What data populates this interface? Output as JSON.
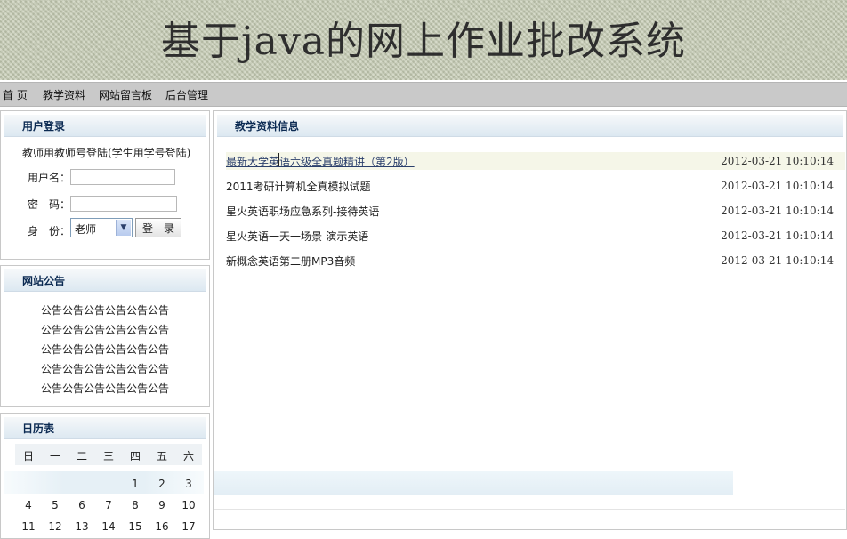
{
  "banner": {
    "title": "基于java的网上作业批改系统"
  },
  "nav": [
    {
      "label": "首 页"
    },
    {
      "label": "教学资料"
    },
    {
      "label": "网站留言板"
    },
    {
      "label": "后台管理"
    }
  ],
  "login": {
    "title": "用户登录",
    "hint": "教师用教师号登陆(学生用学号登陆)",
    "username_label": "用户名：",
    "username_value": "",
    "password_label": "密　码：",
    "password_value": "",
    "role_label": "身　份：",
    "role_value": "老师",
    "submit_label": "登　录"
  },
  "notice": {
    "title": "网站公告",
    "lines": [
      "公告公告公告公告公告公告",
      "公告公告公告公告公告公告",
      "公告公告公告公告公告公告",
      "公告公告公告公告公告公告",
      "公告公告公告公告公告公告"
    ]
  },
  "calendar": {
    "title": "日历表",
    "weekdays": [
      "日",
      "一",
      "二",
      "三",
      "四",
      "五",
      "六"
    ],
    "rows": [
      [
        "",
        "",
        "",
        "",
        "1",
        "2",
        "3"
      ],
      [
        "4",
        "5",
        "6",
        "7",
        "8",
        "9",
        "10"
      ],
      [
        "11",
        "12",
        "13",
        "14",
        "15",
        "16",
        "17"
      ]
    ]
  },
  "resources": {
    "title": "教学资料信息",
    "items": [
      {
        "title": "最新大学英语六级全真题精讲（第2版）",
        "date": "2012-03-21 10:10:14"
      },
      {
        "title": "2011考研计算机全真模拟试题",
        "date": "2012-03-21 10:10:14"
      },
      {
        "title": "星火英语职场应急系列-接待英语",
        "date": "2012-03-21 10:10:14"
      },
      {
        "title": "星火英语一天一场景-演示英语",
        "date": "2012-03-21 10:10:14"
      },
      {
        "title": "新概念英语第二册MP3音频",
        "date": "2012-03-21 10:10:14"
      }
    ]
  },
  "colors": {
    "banner_bg": "#c6ccb4",
    "nav_bg": "#c9c9c9",
    "panel_title": "#0b2a52",
    "link_hover": "#2b3f6b"
  }
}
